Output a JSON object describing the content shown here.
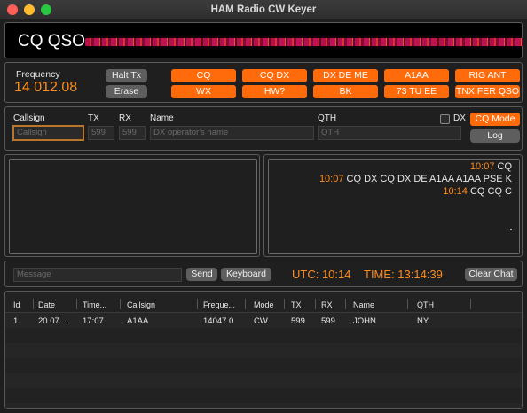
{
  "window": {
    "title": "HAM Radio CW Keyer"
  },
  "banner": {
    "text": "CQ QSO"
  },
  "frequency": {
    "label": "Frequency",
    "value": "14 012.08"
  },
  "controls": {
    "halt_tx": "Halt Tx",
    "erase": "Erase"
  },
  "macros": [
    "CQ",
    "CQ DX",
    "DX DE ME",
    "A1AA",
    "RIG ANT",
    "WX",
    "HW?",
    "BK",
    "73 TU EE",
    "TNX FER QSO"
  ],
  "log_form": {
    "callsign_label": "Callsign",
    "callsign_placeholder": "Callsign",
    "tx_label": "TX",
    "tx_placeholder": "599",
    "rx_label": "RX",
    "rx_placeholder": "599",
    "name_label": "Name",
    "name_placeholder": "DX operator's name",
    "qth_label": "QTH",
    "qth_placeholder": "QTH",
    "dx_label": "DX",
    "cq_mode": "CQ Mode",
    "log_button": "Log"
  },
  "transcript": [
    {
      "time": "10:07",
      "text": "CQ"
    },
    {
      "time": "10:07",
      "text": "CQ DX CQ DX DE A1AA A1AA PSE K"
    },
    {
      "time": "10:14",
      "text": "CQ CQ C"
    }
  ],
  "message_bar": {
    "placeholder": "Message",
    "send": "Send",
    "keyboard": "Keyboard",
    "utc": "UTC: 10:14",
    "time": "TIME: 13:14:39",
    "clear_chat": "Clear Chat"
  },
  "table": {
    "headers": [
      "Id",
      "Date",
      "Time...",
      "Callsign",
      "Freque...",
      "Mode",
      "TX",
      "RX",
      "Name",
      "QTH"
    ],
    "rows": [
      [
        "1",
        "20.07...",
        "17:07",
        "A1AA",
        "14047.0",
        "CW",
        "599",
        "599",
        "JOHN",
        "NY"
      ]
    ]
  },
  "colors": {
    "accent": "#ff6a0a",
    "accent_text": "#ff8c1a",
    "waterfall": "#d4145a"
  }
}
